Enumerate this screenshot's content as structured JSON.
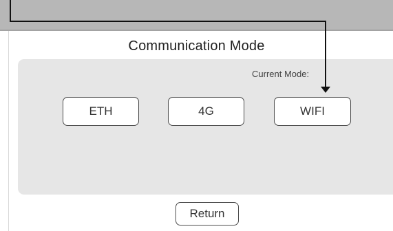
{
  "screen": {
    "title": "Communication Mode",
    "current_mode_label": "Current Mode:",
    "modes": [
      "ETH",
      "4G",
      "WIFI"
    ],
    "return_label": "Return"
  },
  "colors": {
    "top_band": "#b7b7b7",
    "panel": "#e6e6e6",
    "callout_line": "#111111"
  }
}
